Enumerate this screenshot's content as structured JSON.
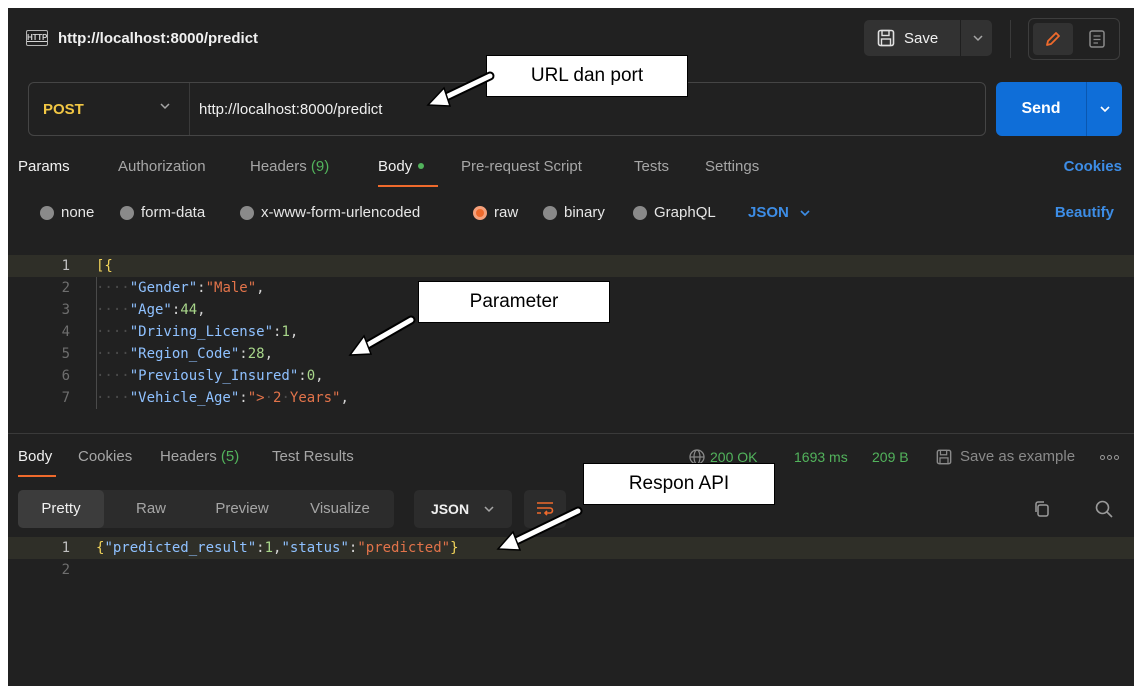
{
  "window": {
    "tab_title": "http://localhost:8000/predict",
    "http_icon_text": "HTTP",
    "save_label": "Save"
  },
  "request": {
    "method": "POST",
    "url": "http://localhost:8000/predict",
    "send_label": "Send"
  },
  "request_tabs": {
    "params": "Params",
    "authorization": "Authorization",
    "headers_label": "Headers",
    "headers_count": "(9)",
    "body": "Body",
    "pre_request": "Pre-request Script",
    "tests": "Tests",
    "settings": "Settings",
    "cookies": "Cookies"
  },
  "body_types": {
    "options": [
      "none",
      "form-data",
      "x-www-form-urlencoded",
      "raw",
      "binary",
      "GraphQL"
    ],
    "selected": "raw",
    "format": "JSON",
    "beautify": "Beautify"
  },
  "request_body": {
    "lines": [
      {
        "n": "1",
        "indent": false,
        "parts": [
          [
            "br",
            "[{"
          ]
        ]
      },
      {
        "n": "2",
        "indent": true,
        "parts": [
          [
            "key",
            "\"Gender\""
          ],
          [
            "pun",
            ":"
          ],
          [
            "str",
            "\"Male\""
          ],
          [
            "pun",
            ","
          ]
        ]
      },
      {
        "n": "3",
        "indent": true,
        "parts": [
          [
            "key",
            "\"Age\""
          ],
          [
            "pun",
            ":"
          ],
          [
            "num",
            "44"
          ],
          [
            "pun",
            ","
          ]
        ]
      },
      {
        "n": "4",
        "indent": true,
        "parts": [
          [
            "key",
            "\"Driving_License\""
          ],
          [
            "pun",
            ":"
          ],
          [
            "num",
            "1"
          ],
          [
            "pun",
            ","
          ]
        ]
      },
      {
        "n": "5",
        "indent": true,
        "parts": [
          [
            "key",
            "\"Region_Code\""
          ],
          [
            "pun",
            ":"
          ],
          [
            "num",
            "28"
          ],
          [
            "pun",
            ","
          ]
        ]
      },
      {
        "n": "6",
        "indent": true,
        "parts": [
          [
            "key",
            "\"Previously_Insured\""
          ],
          [
            "pun",
            ":"
          ],
          [
            "num",
            "0"
          ],
          [
            "pun",
            ","
          ]
        ]
      },
      {
        "n": "7",
        "indent": true,
        "parts": [
          [
            "key",
            "\"Vehicle_Age\""
          ],
          [
            "pun",
            ":"
          ],
          [
            "str",
            "\"> 2 Years\""
          ],
          [
            "pun",
            ","
          ]
        ]
      }
    ]
  },
  "response_tabs": {
    "body": "Body",
    "cookies": "Cookies",
    "headers_label": "Headers",
    "headers_count": "(5)",
    "test_results": "Test Results",
    "status": "200 OK",
    "time": "1693 ms",
    "size": "209 B",
    "save_example": "Save as example"
  },
  "response_view": {
    "modes": [
      "Pretty",
      "Raw",
      "Preview",
      "Visualize"
    ],
    "active_mode": "Pretty",
    "format": "JSON"
  },
  "response_body": {
    "lines": [
      {
        "n": "1",
        "indent": false,
        "parts": [
          [
            "br",
            "{"
          ],
          [
            "key",
            "\"predicted_result\""
          ],
          [
            "pun",
            ":"
          ],
          [
            "num",
            "1"
          ],
          [
            "pun",
            ","
          ],
          [
            "key",
            "\"status\""
          ],
          [
            "pun",
            ":"
          ],
          [
            "str",
            "\"predicted\""
          ],
          [
            "br",
            "}"
          ]
        ]
      },
      {
        "n": "2",
        "indent": false,
        "parts": []
      }
    ]
  },
  "annotations": {
    "url": "URL dan port",
    "parameter": "Parameter",
    "response": "Respon API"
  },
  "colors": {
    "background": "#212121",
    "accent_orange": "#ef6a2c",
    "send_blue": "#0f6ed8",
    "link_blue": "#3d8de6",
    "success_green": "#52b35c",
    "method_yellow": "#f2c744"
  }
}
